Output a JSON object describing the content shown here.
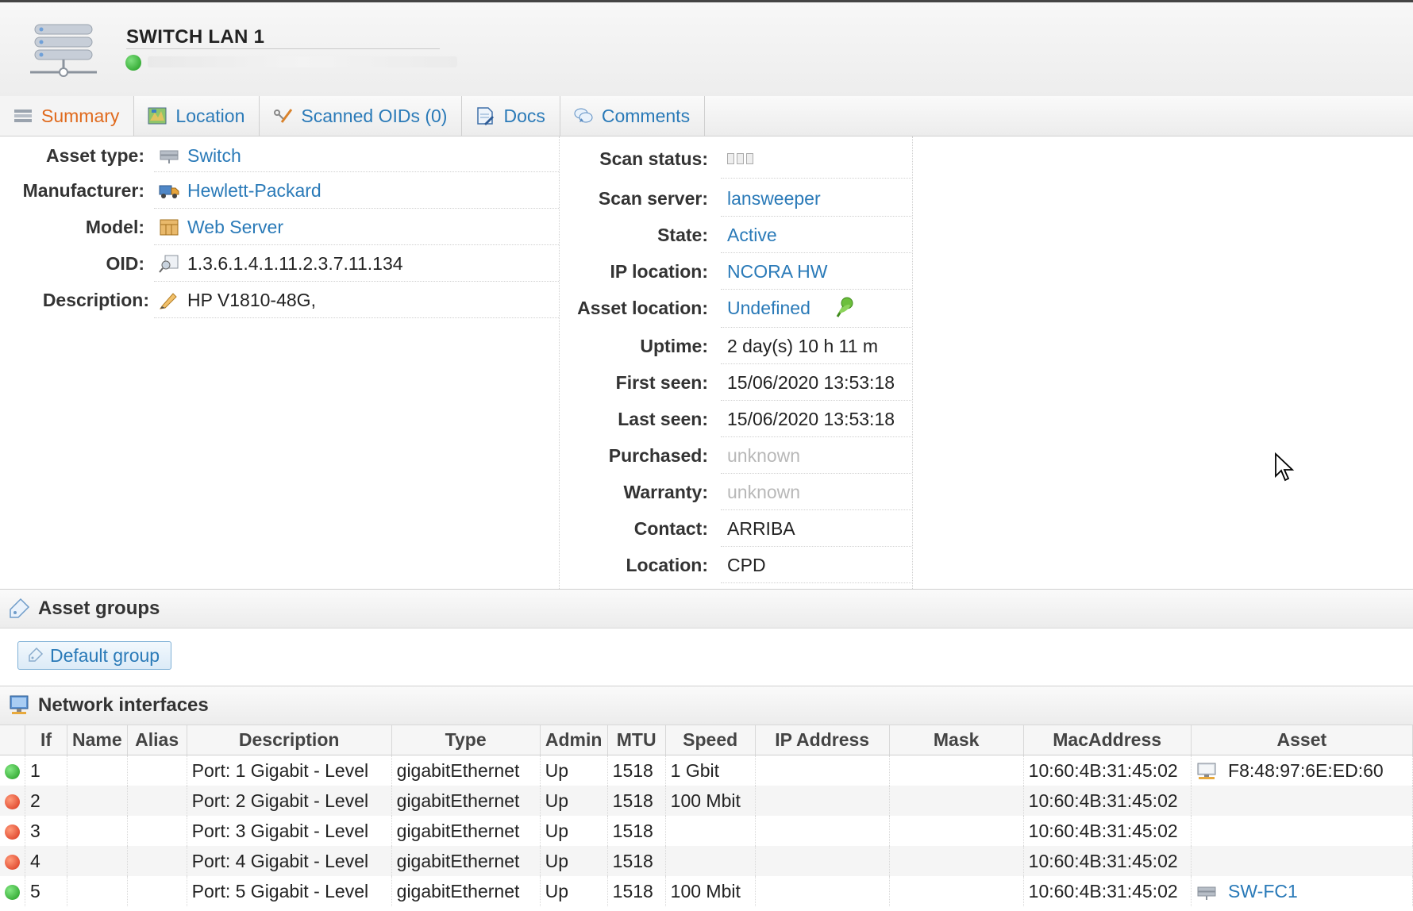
{
  "header": {
    "title": "SWITCH LAN 1",
    "status_color": "#2aa52a"
  },
  "tabs": [
    {
      "label": "Summary",
      "icon": "summary-icon",
      "active": true
    },
    {
      "label": "Location",
      "icon": "map-icon",
      "active": false
    },
    {
      "label": "Scanned OIDs (0)",
      "icon": "oid-icon",
      "active": false
    },
    {
      "label": "Docs",
      "icon": "docs-icon",
      "active": false
    },
    {
      "label": "Comments",
      "icon": "comments-icon",
      "active": false
    }
  ],
  "summary_left": [
    {
      "label": "Asset type:",
      "value": "Switch",
      "icon": "switch-icon",
      "link": true
    },
    {
      "label": "Manufacturer:",
      "value": "Hewlett-Packard",
      "icon": "truck-icon",
      "link": true
    },
    {
      "label": "Model:",
      "value": "Web Server",
      "icon": "model-icon",
      "link": true
    },
    {
      "label": "OID:",
      "value": "1.3.6.1.4.1.11.2.3.7.11.134",
      "icon": "oid-icon",
      "link": false
    },
    {
      "label": "Description:",
      "value": "HP V1810-48G,",
      "icon": "pencil-icon",
      "link": false
    }
  ],
  "summary_right": [
    {
      "label": "Scan status:",
      "value": "",
      "style": "bars"
    },
    {
      "label": "Scan server:",
      "value": "lansweeper",
      "style": "link"
    },
    {
      "label": "State:",
      "value": "Active",
      "style": "link"
    },
    {
      "label": "IP location:",
      "value": "NCORA HW",
      "style": "link"
    },
    {
      "label": "Asset location:",
      "value": "Undefined",
      "style": "link"
    },
    {
      "label": "Uptime:",
      "value": "2 day(s) 10 h 11 m",
      "style": "plain"
    },
    {
      "label": "First seen:",
      "value": "15/06/2020 13:53:18",
      "style": "plain"
    },
    {
      "label": "Last seen:",
      "value": "15/06/2020 13:53:18",
      "style": "plain"
    },
    {
      "label": "Purchased:",
      "value": "unknown",
      "style": "muted"
    },
    {
      "label": "Warranty:",
      "value": "unknown",
      "style": "muted"
    },
    {
      "label": "Contact:",
      "value": "ARRIBA",
      "style": "plain"
    },
    {
      "label": "Location:",
      "value": "CPD",
      "style": "plain"
    }
  ],
  "asset_groups": {
    "title": "Asset groups",
    "groups": [
      "Default group"
    ]
  },
  "network": {
    "title": "Network interfaces",
    "columns": [
      "If",
      "Name",
      "Alias",
      "Description",
      "Type",
      "Admin",
      "MTU",
      "Speed",
      "IP Address",
      "Mask",
      "MacAddress",
      "Asset"
    ],
    "rows": [
      {
        "status": "green",
        "if": "1",
        "name": "",
        "alias": "",
        "description": "Port: 1 Gigabit - Level",
        "type": "gigabitEthernet",
        "admin": "Up",
        "mtu": "1518",
        "speed": "1 Gbit",
        "ip": "",
        "mask": "",
        "mac": "10:60:4B:31:45:02",
        "asset": "F8:48:97:6E:ED:60",
        "asset_icon": "computer-icon",
        "asset_link": false
      },
      {
        "status": "red",
        "if": "2",
        "name": "",
        "alias": "",
        "description": "Port: 2 Gigabit - Level",
        "type": "gigabitEthernet",
        "admin": "Up",
        "mtu": "1518",
        "speed": "100 Mbit",
        "ip": "",
        "mask": "",
        "mac": "10:60:4B:31:45:02",
        "asset": "",
        "asset_icon": "",
        "asset_link": false
      },
      {
        "status": "red",
        "if": "3",
        "name": "",
        "alias": "",
        "description": "Port: 3 Gigabit - Level",
        "type": "gigabitEthernet",
        "admin": "Up",
        "mtu": "1518",
        "speed": "",
        "ip": "",
        "mask": "",
        "mac": "10:60:4B:31:45:02",
        "asset": "",
        "asset_icon": "",
        "asset_link": false
      },
      {
        "status": "red",
        "if": "4",
        "name": "",
        "alias": "",
        "description": "Port: 4 Gigabit - Level",
        "type": "gigabitEthernet",
        "admin": "Up",
        "mtu": "1518",
        "speed": "",
        "ip": "",
        "mask": "",
        "mac": "10:60:4B:31:45:02",
        "asset": "",
        "asset_icon": "",
        "asset_link": false
      },
      {
        "status": "green",
        "if": "5",
        "name": "",
        "alias": "",
        "description": "Port: 5 Gigabit - Level",
        "type": "gigabitEthernet",
        "admin": "Up",
        "mtu": "1518",
        "speed": "100 Mbit",
        "ip": "",
        "mask": "",
        "mac": "10:60:4B:31:45:02",
        "asset": "SW-FC1",
        "asset_icon": "switch-icon",
        "asset_link": true
      }
    ]
  }
}
